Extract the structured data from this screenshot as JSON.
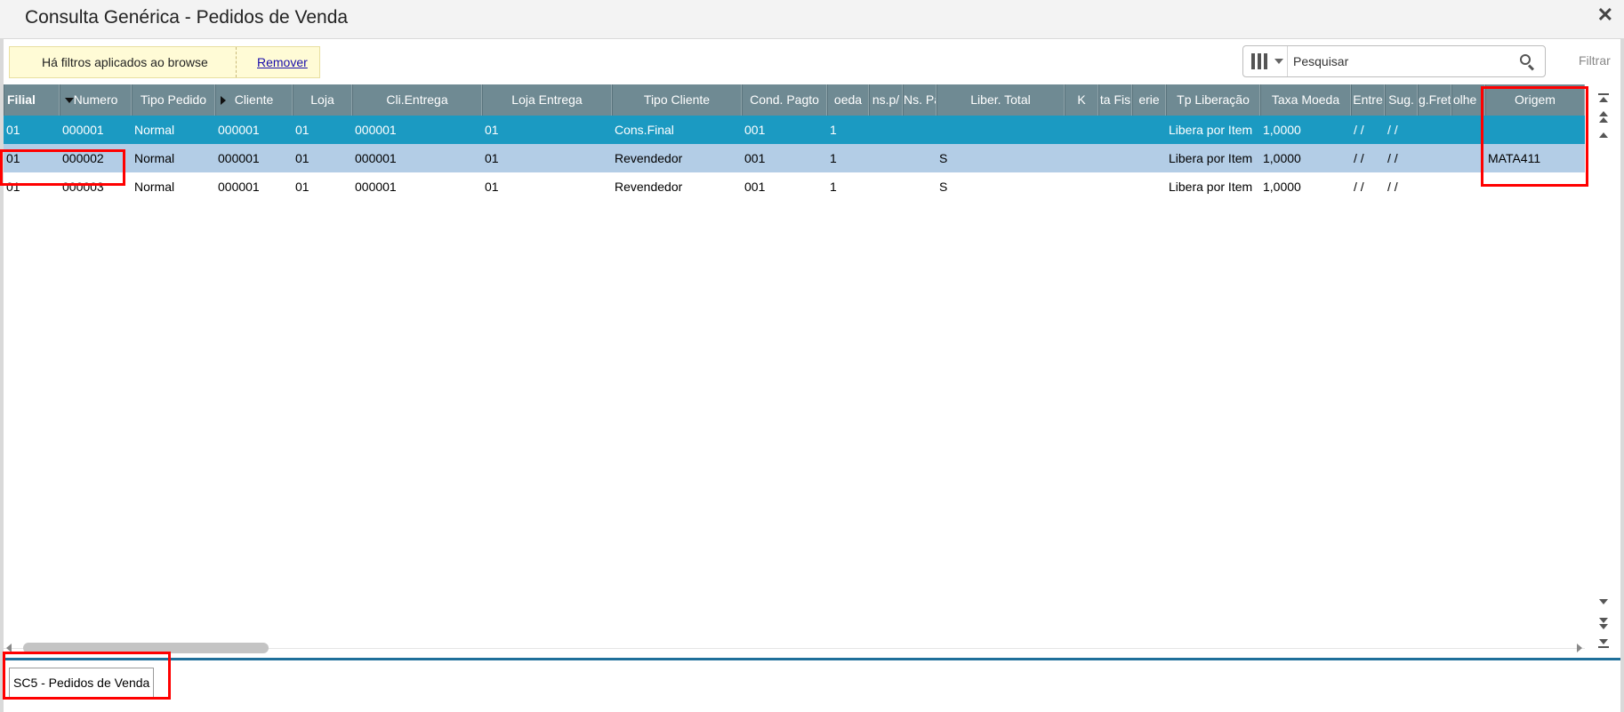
{
  "window": {
    "title": "Consulta Genérica - Pedidos de Venda",
    "close_symbol": "✕"
  },
  "filter_notice": {
    "text": "Há filtros aplicados ao browse",
    "remove_label": "Remover"
  },
  "search": {
    "placeholder": "Pesquisar",
    "filter_label": "Filtrar"
  },
  "grid": {
    "headers": [
      "Filial",
      "Numero",
      "Tipo Pedido",
      "Cliente",
      "Loja",
      "Cli.Entrega",
      "Loja Entrega",
      "Tipo Cliente",
      "Cond. Pagto",
      "oeda",
      "ns.p/",
      "Ns. Pa",
      "Liber. Total",
      "K",
      "ta Fis",
      "erie",
      "Tp Liberação",
      "Taxa Moeda",
      "Entre",
      "Sug.",
      "g.Fret",
      "olhe I",
      "Origem"
    ],
    "rows": [
      [
        "01",
        "000001",
        "Normal",
        "000001",
        "01",
        "000001",
        "01",
        "Cons.Final",
        "001",
        "1",
        "",
        "",
        "",
        "",
        "",
        "",
        "Libera por Item",
        "1,0000",
        "/ /",
        "/ /",
        "",
        "",
        ""
      ],
      [
        "01",
        "000002",
        "Normal",
        "000001",
        "01",
        "000001",
        "01",
        "Revendedor",
        "001",
        "1",
        "",
        "",
        "S",
        "",
        "",
        "",
        "Libera por Item",
        "1,0000",
        "/ /",
        "/ /",
        "",
        "",
        "MATA411"
      ],
      [
        "01",
        "000003",
        "Normal",
        "000001",
        "01",
        "000001",
        "01",
        "Revendedor",
        "001",
        "1",
        "",
        "",
        "S",
        "",
        "",
        "",
        "Libera por Item",
        "1,0000",
        "/ /",
        "/ /",
        "",
        "",
        ""
      ]
    ]
  },
  "tabs": [
    {
      "label": "SC5 - Pedidos de Venda"
    }
  ],
  "colors": {
    "header_bg": "#6f8a93",
    "row_selected": "#1b9ac2",
    "row_alt": "#b3cde6",
    "highlight": "#ff0000",
    "filter_bg": "#fffbd6"
  }
}
